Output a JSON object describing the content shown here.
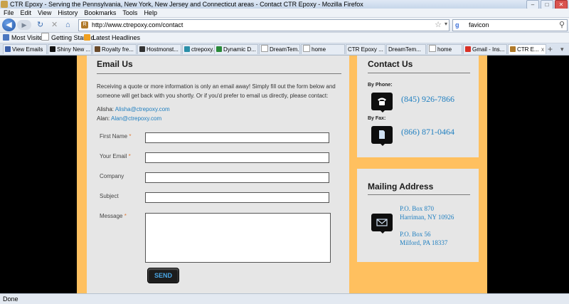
{
  "window": {
    "title": "CTR Epoxy - Serving the Pennsylvania, New York, New Jersey and Connecticut areas - Contact CTR Epoxy - Mozilla Firefox",
    "min": "–",
    "max": "□",
    "close": "✕"
  },
  "menu": [
    "File",
    "Edit",
    "View",
    "History",
    "Bookmarks",
    "Tools",
    "Help"
  ],
  "nav": {
    "back": "◀",
    "forward": "▶",
    "reload": "↻",
    "stop": "✕",
    "home": "⌂",
    "url": "http://www.ctrepoxy.com/contact",
    "search_engine": "g",
    "search_value": "favicon",
    "star": "☆",
    "dropdown": "▾",
    "search_go": "⚲",
    "favicon_letter": "R"
  },
  "bookmarks": [
    "Most Visited",
    "Getting Started",
    "Latest Headlines"
  ],
  "tabs": [
    {
      "label": "View Emails"
    },
    {
      "label": "Shiny New ..."
    },
    {
      "label": "Royalty fre..."
    },
    {
      "label": "Hostmonst..."
    },
    {
      "label": "ctrepoxy.c..."
    },
    {
      "label": "Dynamic D..."
    },
    {
      "label": "DreamTem..."
    },
    {
      "label": "home"
    },
    {
      "label": "CTR Epoxy ..."
    },
    {
      "label": "DreamTem..."
    },
    {
      "label": "home"
    },
    {
      "label": "Gmail - Ins..."
    },
    {
      "label": "CTR E..."
    }
  ],
  "tab_close": "x",
  "tab_new": "+",
  "tab_list": "▾",
  "email": {
    "heading": "Email Us",
    "intro": "Receiving a quote or more information is only an email away! Simply fill out the form below and someone will get back with you shortly. Or if you'd prefer to email us directly, please contact:",
    "contacts": [
      {
        "name": "Alisha:",
        "email": "Alisha@ctrepoxy.com"
      },
      {
        "name": "Alan:",
        "email": "Alan@ctrepoxy.com"
      }
    ],
    "form": {
      "first_name": "First Name",
      "your_email": "Your Email",
      "company": "Company",
      "subject": "Subject",
      "message": "Message",
      "required_mark": "*",
      "send": "SEND"
    }
  },
  "contact": {
    "heading": "Contact Us",
    "by_phone": "By Phone:",
    "phone": "(845) 926-7866",
    "by_fax": "By Fax:",
    "fax": "(866) 871-0464"
  },
  "mailing": {
    "heading": "Mailing Address",
    "lines1": [
      "P.O. Box 870",
      "Harriman, NY 10926"
    ],
    "lines2": [
      "P.O. Box 56",
      "Milford, PA 18337"
    ]
  },
  "status": "Done"
}
